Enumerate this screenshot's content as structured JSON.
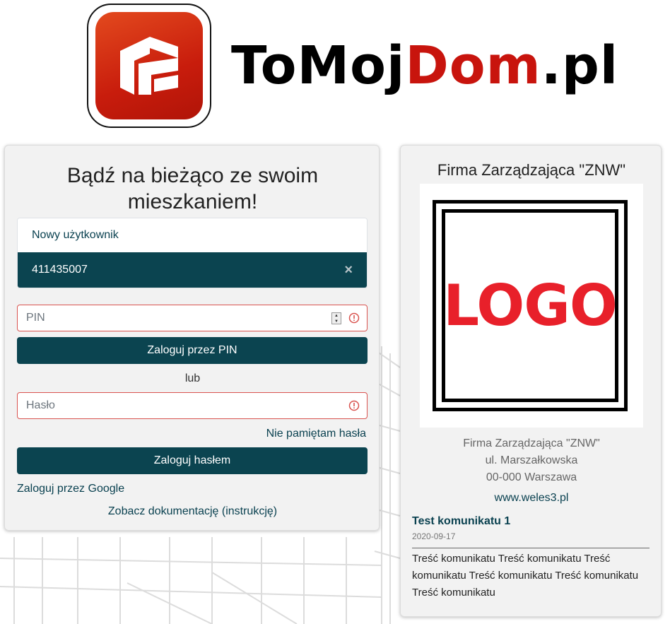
{
  "brand": {
    "name_part1": "ToMoj",
    "name_part2": "Dom",
    "name_part3": ".pl",
    "accent_color": "#c8140d"
  },
  "login": {
    "title": "Bądź na bieżąco ze swoim mieszkaniem!",
    "users": [
      {
        "label": "Nowy użytkownik",
        "active": false
      },
      {
        "label": "411435007",
        "active": true
      }
    ],
    "remove_icon": "×",
    "pin_placeholder": "PIN",
    "pin_button": "Zaloguj przez PIN",
    "or_text": "lub",
    "password_placeholder": "Hasło",
    "forgot_password": "Nie pamiętam hasła",
    "password_button": "Zaloguj hasłem",
    "google_login": "Zaloguj przez Google",
    "documentation": "Zobacz dokumentację (instrukcję)"
  },
  "company": {
    "title": "Firma Zarządzająca \"ZNW\"",
    "logo_text": "LOGO",
    "address": {
      "name": "Firma Zarządzająca \"ZNW\"",
      "street": "ul. Marszałkowska",
      "city": "00-000 Warszawa"
    },
    "website": "www.weles3.pl",
    "news": {
      "title": "Test komunikatu 1",
      "date": "2020-09-17",
      "body": "Treść komunikatu Treść komunikatu Treść komunikatu Treść komunikatu Treść komunikatu Treść komunikatu"
    }
  },
  "colors": {
    "primary": "#0b4450",
    "error_border": "#d9534f",
    "logo_red": "#e8202a"
  }
}
